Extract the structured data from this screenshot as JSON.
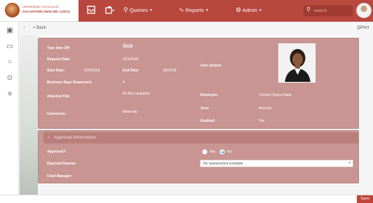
{
  "header": {
    "logo_line1": "UNIVERSIDAD CATÓLICA DE",
    "logo_line2": "SAN ANTONIO ABAD DEL CUSCO",
    "nav": [
      {
        "label": "Queries"
      },
      {
        "label": "Reports"
      },
      {
        "label": "Admin"
      }
    ],
    "search_placeholder": "Search"
  },
  "toolbar": {
    "back_label": "< Back",
    "print_label": "Print"
  },
  "request": {
    "type_label": "Type time Off:",
    "type_value": "Sick",
    "request_date_label": "Request Date:",
    "request_date_value": "2/21/2018",
    "start_label": "Start Date:",
    "start_value": "2/28/2018",
    "end_label": "End Date:",
    "end_value": "3/8/2018",
    "business_days_label": "Business Days Requested:",
    "business_days_value": "4",
    "attached_label": "Attached File:",
    "attached_value": "No files uploaded",
    "comments_label": "Comments:",
    "comments_value": "Maternity",
    "user_picture_label": "User picture:",
    "employee_label": "Employee:",
    "employee_value": "Carmen Quiroz Bajar",
    "area_label": "Area:",
    "area_value": "Account",
    "enabled_label": "Enabled:",
    "enabled_value": "Yes"
  },
  "approval": {
    "title": "Approval Information",
    "approved_label": "Approved?:",
    "yes_label": "Yes",
    "no_label": "No",
    "selected": "No",
    "rejected_label": "Rejected Reason:",
    "rejected_value": "No replacement available.",
    "chief_label": "Chief Manager:"
  },
  "footer": {
    "save_label": "Save"
  },
  "colors": {
    "brand": "#b8473e",
    "panel": "#c89592",
    "save": "#c0443a"
  }
}
